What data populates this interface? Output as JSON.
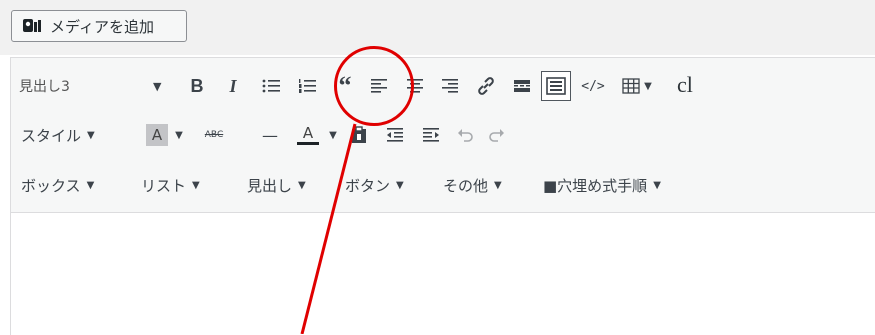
{
  "media_button": {
    "label": "メディアを追加",
    "icon": "media-icon"
  },
  "toolbar1": {
    "format_select": "見出し3",
    "bold": "B",
    "italic": "I",
    "code_label": "</>",
    "cl_label": "cl"
  },
  "toolbar2": {
    "style_label": "スタイル",
    "text_color_label": "A",
    "strike_label": "ABC",
    "hr_label": "—",
    "bg_color_label": "A"
  },
  "toolbar3": {
    "menus": [
      "ボックス",
      "リスト",
      "見出し",
      "ボタン",
      "その他",
      "■穴埋め式手順"
    ]
  },
  "annotation": {
    "color": "#e00000"
  }
}
